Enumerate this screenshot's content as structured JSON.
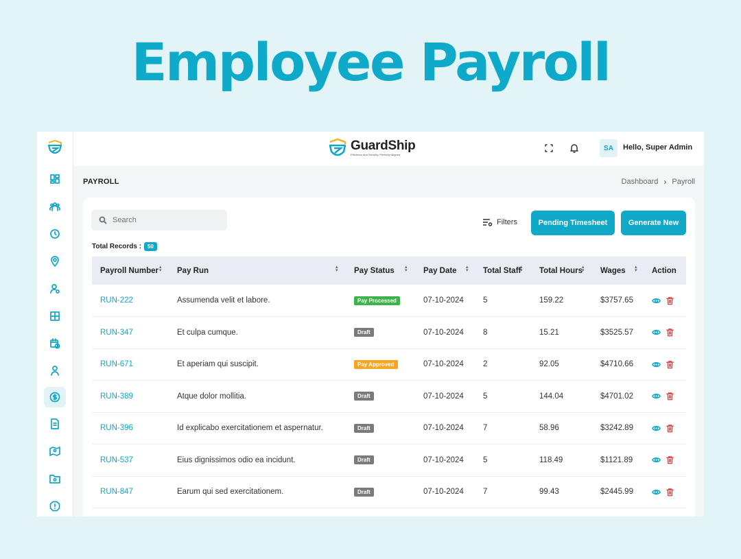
{
  "hero": {
    "title": "Employee Payroll"
  },
  "brand": {
    "name": "GuardShip",
    "tagline": "Efficiency and Security, Perfectly Aligned."
  },
  "user": {
    "initials": "SA",
    "greeting": "Hello, Super Admin"
  },
  "sidebar": {
    "items": [
      {
        "icon": "dashboard-icon"
      },
      {
        "icon": "team-icon"
      },
      {
        "icon": "clock-icon"
      },
      {
        "icon": "location-pin-icon"
      },
      {
        "icon": "user-settings-icon"
      },
      {
        "icon": "layout-icon"
      },
      {
        "icon": "calendar-clock-icon"
      },
      {
        "icon": "user-icon"
      },
      {
        "icon": "dollar-icon",
        "active": true
      },
      {
        "icon": "document-icon"
      },
      {
        "icon": "map-person-icon"
      },
      {
        "icon": "folder-icon"
      },
      {
        "icon": "alert-icon"
      }
    ]
  },
  "page": {
    "title": "PAYROLL",
    "breadcrumb": [
      "Dashboard",
      "Payroll"
    ]
  },
  "toolbar": {
    "search_placeholder": "Search",
    "filters_label": "Filters",
    "pending_label": "Pending Timesheet",
    "generate_label": "Generate New"
  },
  "records": {
    "label": "Total Records :",
    "count": "50"
  },
  "table": {
    "columns": [
      "Payroll Number",
      "Pay Run",
      "Pay Status",
      "Pay Date",
      "Total Staff",
      "Total Hours",
      "Wages",
      "Action"
    ],
    "rows": [
      {
        "number": "RUN-222",
        "run": "Assumenda velit et labore.",
        "status": "Pay Processed",
        "status_color": "#3bb54a",
        "date": "07-10-2024",
        "staff": "5",
        "hours": "159.22",
        "wages": "$3757.65"
      },
      {
        "number": "RUN-347",
        "run": "Et culpa cumque.",
        "status": "Draft",
        "status_color": "#7a7a7a",
        "date": "07-10-2024",
        "staff": "8",
        "hours": "15.21",
        "wages": "$3525.57"
      },
      {
        "number": "RUN-671",
        "run": "Et aperiam qui suscipit.",
        "status": "Pay Approved",
        "status_color": "#f5a623",
        "date": "07-10-2024",
        "staff": "2",
        "hours": "92.05",
        "wages": "$4710.66"
      },
      {
        "number": "RUN-389",
        "run": "Atque dolor mollitia.",
        "status": "Draft",
        "status_color": "#7a7a7a",
        "date": "07-10-2024",
        "staff": "5",
        "hours": "144.04",
        "wages": "$4701.02"
      },
      {
        "number": "RUN-396",
        "run": "Id explicabo exercitationem et aspernatur.",
        "status": "Draft",
        "status_color": "#7a7a7a",
        "date": "07-10-2024",
        "staff": "7",
        "hours": "58.96",
        "wages": "$3242.89"
      },
      {
        "number": "RUN-537",
        "run": "Eius dignissimos odio ea incidunt.",
        "status": "Draft",
        "status_color": "#7a7a7a",
        "date": "07-10-2024",
        "staff": "5",
        "hours": "118.49",
        "wages": "$1121.89"
      },
      {
        "number": "RUN-847",
        "run": "Earum qui sed exercitationem.",
        "status": "Draft",
        "status_color": "#7a7a7a",
        "date": "07-10-2024",
        "staff": "7",
        "hours": "99.43",
        "wages": "$2445.99"
      }
    ]
  },
  "colors": {
    "accent": "#12a9c8",
    "hero": "#0fa9c9",
    "delete": "#e8484d"
  }
}
